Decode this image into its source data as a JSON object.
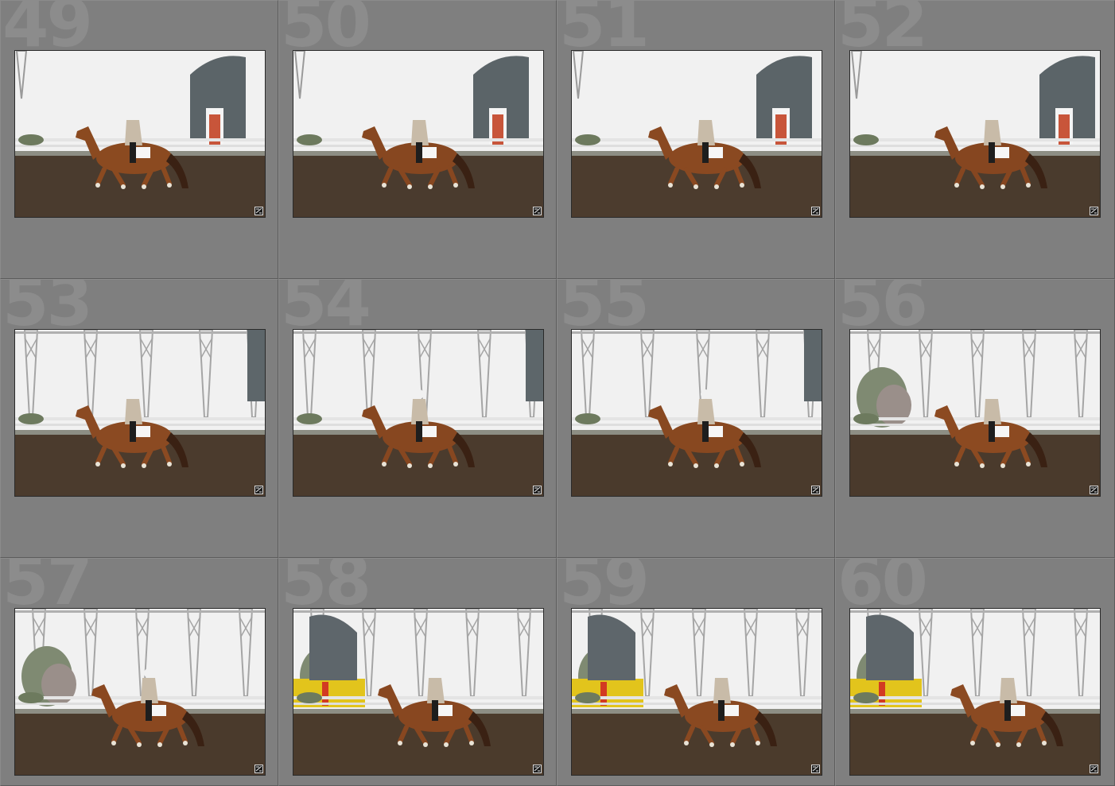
{
  "grid": {
    "thumbnails": [
      {
        "number": "49",
        "scene": "arena-wall",
        "arena_color": "#4a3b2e",
        "horse_color": "#8b4a20",
        "has_trees": false,
        "has_yellow": false
      },
      {
        "number": "50",
        "scene": "arena-wall",
        "arena_color": "#4a3b2e",
        "horse_color": "#874720",
        "has_trees": false,
        "has_yellow": false
      },
      {
        "number": "51",
        "scene": "arena-wall",
        "arena_color": "#4c3c2e",
        "horse_color": "#8a4921",
        "has_trees": false,
        "has_yellow": false
      },
      {
        "number": "52",
        "scene": "arena-wall",
        "arena_color": "#4a3b2d",
        "horse_color": "#864620",
        "has_trees": false,
        "has_yellow": false
      },
      {
        "number": "53",
        "scene": "arena-frame",
        "arena_color": "#4b3b2d",
        "horse_color": "#8b4a22",
        "has_trees": false,
        "has_yellow": false
      },
      {
        "number": "54",
        "scene": "arena-frame",
        "arena_color": "#4b3b2d",
        "horse_color": "#874720",
        "has_trees": false,
        "has_yellow": false
      },
      {
        "number": "55",
        "scene": "arena-frame",
        "arena_color": "#4a3a2c",
        "horse_color": "#884820",
        "has_trees": false,
        "has_yellow": false
      },
      {
        "number": "56",
        "scene": "arena-trees",
        "arena_color": "#4a3a2c",
        "horse_color": "#8c4a21",
        "has_trees": true,
        "has_yellow": false
      },
      {
        "number": "57",
        "scene": "arena-trees",
        "arena_color": "#4a3a2c",
        "horse_color": "#8a4820",
        "has_trees": true,
        "has_yellow": false
      },
      {
        "number": "58",
        "scene": "arena-trees",
        "arena_color": "#4b3b2c",
        "horse_color": "#884720",
        "has_trees": true,
        "has_yellow": true
      },
      {
        "number": "59",
        "scene": "arena-trees",
        "arena_color": "#4b3b2c",
        "horse_color": "#8a4921",
        "has_trees": true,
        "has_yellow": true
      },
      {
        "number": "60",
        "scene": "arena-trees",
        "arena_color": "#4b3b2c",
        "horse_color": "#8b4a22",
        "has_trees": true,
        "has_yellow": true
      }
    ],
    "badge_icon": "edit-adjustments-icon"
  }
}
